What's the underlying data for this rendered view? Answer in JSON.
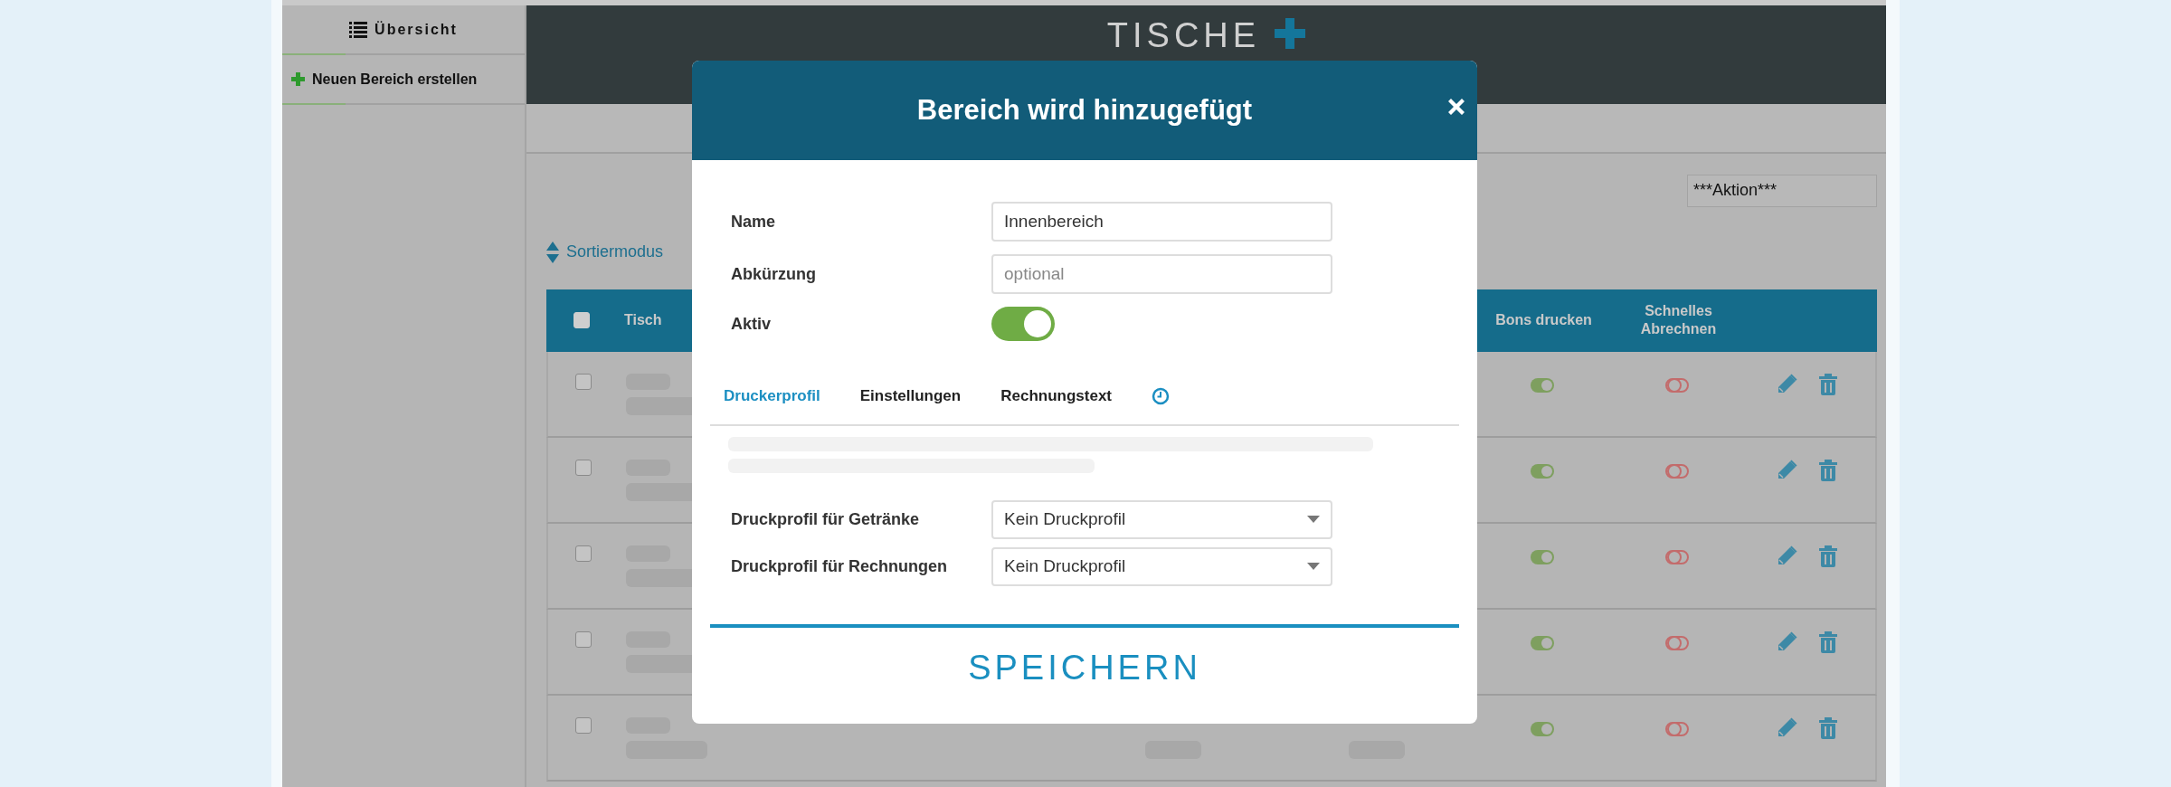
{
  "sidebar": {
    "items": [
      {
        "label": "Übersicht",
        "kind": "header"
      },
      {
        "label": "Neuen Bereich erstellen",
        "kind": "action"
      }
    ]
  },
  "header": {
    "title": "TISCHE"
  },
  "toolbar": {
    "action_select": "***Aktion***",
    "sort_link": "Sortiermodus"
  },
  "table": {
    "select_all_checked": false,
    "columns": [
      {
        "label": "Tisch",
        "kind": "name"
      },
      {
        "label": "Bons drucken",
        "kind": "bons"
      },
      {
        "label": "Schnelles Abrechnen",
        "kind": "schnell"
      }
    ],
    "rows": [
      {
        "selected": false,
        "bons_drucken": true,
        "schnelles_abrechnen": false
      },
      {
        "selected": false,
        "bons_drucken": true,
        "schnelles_abrechnen": false
      },
      {
        "selected": false,
        "bons_drucken": true,
        "schnelles_abrechnen": false
      },
      {
        "selected": false,
        "bons_drucken": true,
        "schnelles_abrechnen": false
      },
      {
        "selected": false,
        "bons_drucken": true,
        "schnelles_abrechnen": false
      }
    ]
  },
  "modal": {
    "title": "Bereich wird hinzugefügt",
    "fields": [
      {
        "label": "Name",
        "kind": "text",
        "value": "Innenbereich"
      },
      {
        "label": "Abkürzung",
        "kind": "text",
        "placeholder": "optional"
      },
      {
        "label": "Aktiv",
        "kind": "toggle",
        "on": true
      }
    ],
    "tabs": [
      {
        "label": "Druckerprofil",
        "kind": "text",
        "selected": true
      },
      {
        "label": "Einstellungen",
        "kind": "text",
        "selected": false
      },
      {
        "label": "Rechnungstext",
        "kind": "text",
        "selected": false
      },
      {
        "kind": "icon",
        "selected": false
      }
    ],
    "selects": [
      {
        "label": "Druckprofil für Getränke",
        "value": "Kein Druckprofil"
      },
      {
        "label": "Druckprofil für Rechnungen",
        "value": "Kein Druckprofil"
      }
    ],
    "save": "SPEICHERN"
  }
}
